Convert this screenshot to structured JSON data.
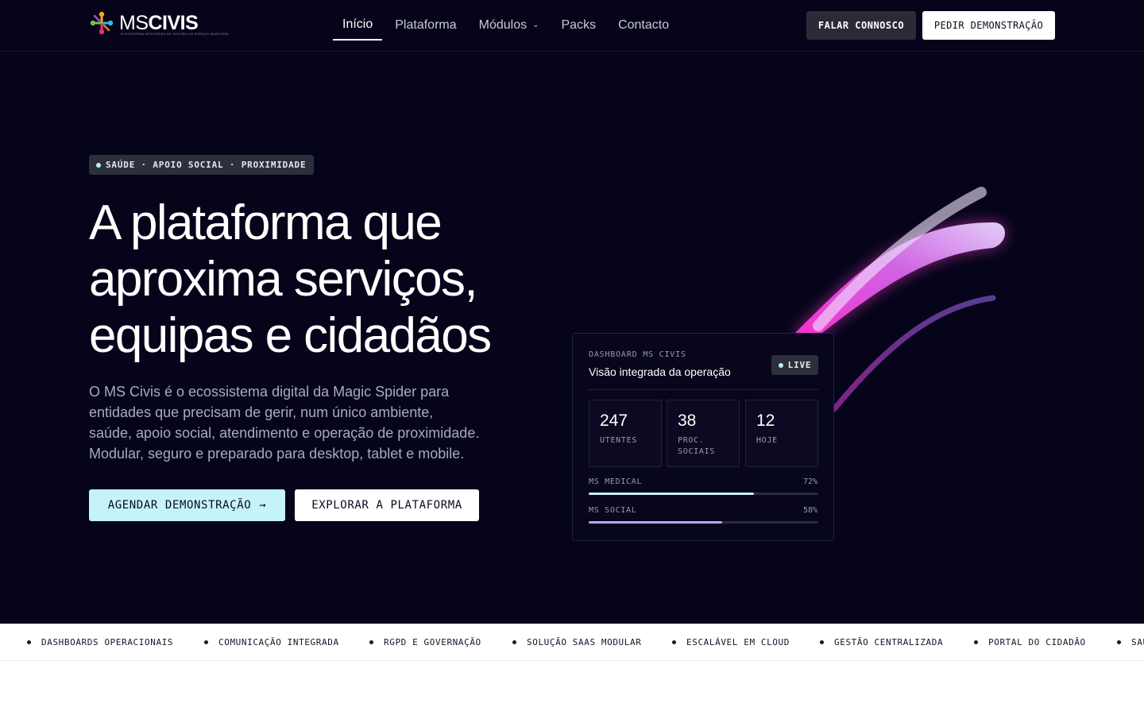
{
  "brand": {
    "name_light": "MS",
    "name_bold": "CIVIS",
    "tagline": "PLATAFORMA INTEGRADA DE GESTÃO DE ESPAÇO MUNICIPAL"
  },
  "nav": {
    "items": [
      {
        "label": "Início",
        "active": true
      },
      {
        "label": "Plataforma"
      },
      {
        "label": "Módulos",
        "has_dropdown": true
      },
      {
        "label": "Packs"
      },
      {
        "label": "Contacto"
      }
    ]
  },
  "header_actions": {
    "talk_label": "FALAR CONNOSCO",
    "demo_label": "PEDIR DEMONSTRAÇÃO"
  },
  "hero": {
    "badge": "SAÚDE · APOIO SOCIAL · PROXIMIDADE",
    "headline_lines": [
      "A plataforma que",
      "aproxima serviços,",
      "equipas e cidadãos"
    ],
    "lede_lines": [
      "O MS Civis é o ecossistema digital da Magic Spider para",
      "entidades que precisam de gerir, num único ambiente,",
      "saúde, apoio social, atendimento e operação de proximidade.",
      "Modular, seguro e preparado para desktop, tablet e mobile."
    ],
    "cta_primary": "AGENDAR DEMONSTRAÇÃO",
    "cta_primary_arrow": "→",
    "cta_secondary": "EXPLORAR A PLATAFORMA"
  },
  "dashboard": {
    "kicker": "DASHBOARD MS CIVIS",
    "title": "Visão integrada da operação",
    "live_label": "LIVE",
    "stats": [
      {
        "value": "247",
        "label": "UTENTES"
      },
      {
        "value": "38",
        "label": "PROC. SOCIAIS"
      },
      {
        "value": "12",
        "label": "HOJE"
      }
    ],
    "progress": [
      {
        "label": "MS MEDICAL",
        "percent_text": "72%",
        "value": 0.72,
        "color": "#c5f3fb"
      },
      {
        "label": "MS SOCIAL",
        "percent_text": "58%",
        "value": 0.58,
        "color": "#b9a8f5"
      }
    ]
  },
  "marquee": {
    "items": [
      "DASHBOARDS OPERACIONAIS",
      "COMUNICAÇÃO INTEGRADA",
      "RGPD E GOVERNAÇÃO",
      "SOLUÇÃO SAAS MODULAR",
      "ESCALÁVEL EM CLOUD",
      "GESTÃO CENTRALIZADA",
      "PORTAL DO CIDADÃO",
      "SAÚDE"
    ]
  },
  "colors": {
    "background": "#05041a",
    "accent_cyan": "#c5f3fb",
    "accent_violet": "#b9a8f5",
    "ribbon_magenta": "#ff3fd0"
  }
}
